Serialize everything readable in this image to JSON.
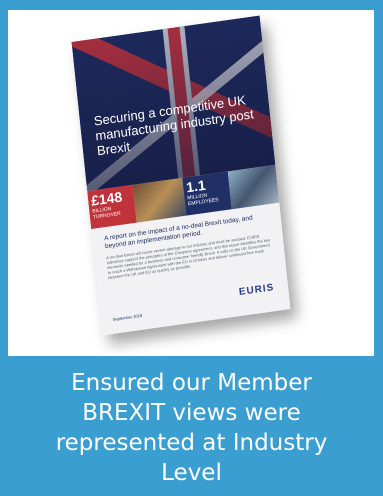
{
  "caption": {
    "line1": "Ensured our Member",
    "line2": "BREXIT  views were",
    "line3": "represented at  Industry",
    "line4": "Level"
  },
  "report": {
    "title": "Securing a competitive UK manufacturing industry post Brexit",
    "stat1_value": "£148",
    "stat1_unit": "BILLION",
    "stat1_label": "TURNOVER",
    "stat2_value": "1.1",
    "stat2_unit": "MILLION",
    "stat2_label": "EMPLOYEES",
    "subtitle": "A report on the impact of a no-deal Brexit today, and beyond an implementation period.",
    "body": "A no-deal Brexit will cause severe damage to our industry and must be avoided. EURIS industries support the principles of the Chequers agreement, and this report identifies the key elements needed for a business and consumer friendly Brexit. It calls on the UK Government to reach a Withdrawal Agreement with the EU in October and deliver continued free trade between the UK and EU as quickly as possible.",
    "date": "September 2018",
    "logo": "EURIS"
  },
  "colors": {
    "panel_blue": "#3a9ed0",
    "flag_blue": "#1f2d63",
    "flag_red": "#c9343d"
  }
}
